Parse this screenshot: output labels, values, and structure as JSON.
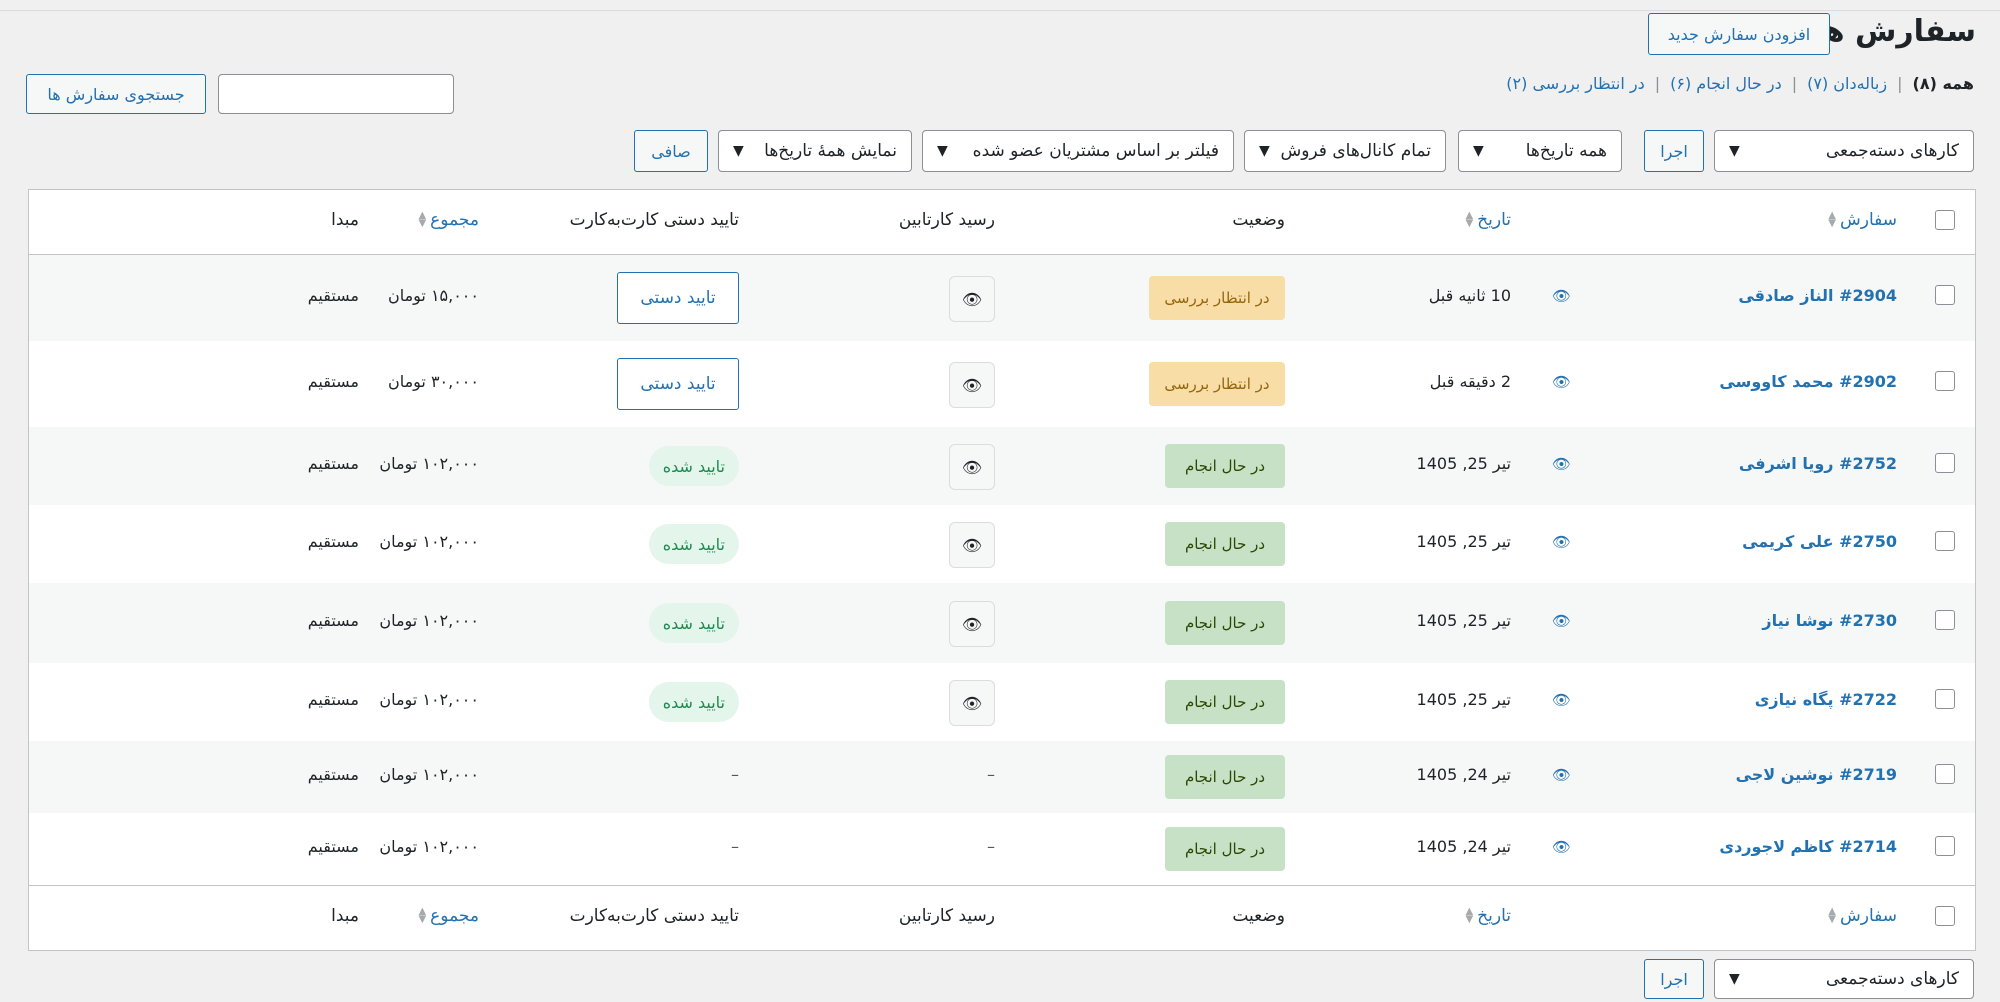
{
  "header": {
    "title": "سفارش ها",
    "add_new": "افزودن سفارش جدید"
  },
  "status_links": [
    {
      "label": "همه",
      "count": "(۸)"
    },
    {
      "label": "زباله‌دان",
      "count": "(۷)"
    },
    {
      "label": "در حال انجام",
      "count": "(۶)"
    },
    {
      "label": "در انتظار بررسی",
      "count": "(۲)"
    }
  ],
  "search": {
    "button": "جستجوی سفارش ها",
    "value": ""
  },
  "filters": {
    "bulk_actions": "کارهای دسته‌جمعی",
    "apply": "اجرا",
    "all_dates": "همه تاریخ‌ها",
    "sales_channels": "تمام کانال‌های فروش",
    "customer_filter": "فیلتر بر اساس مشتریان عضو شده",
    "show_all_dates": "نمایش همهٔ تاریخ‌ها",
    "filter_button": "صافی"
  },
  "columns": {
    "order": "سفارش",
    "date": "تاریخ",
    "status": "وضعیت",
    "receipt": "رسید کارتابین",
    "manual": "تایید دستی کارت‌به‌کارت",
    "total": "مجموع",
    "origin": "مبدا"
  },
  "orders": [
    {
      "name": "#2904 الناز صادقی",
      "date": "10 ثانیه قبل",
      "status": "در انتظار بررسی",
      "status_type": "pending",
      "receipt": "👁",
      "manual": "تایید دستی",
      "manual_type": "button",
      "total": "۱۵,۰۰۰ تومان",
      "origin": "مستقیم"
    },
    {
      "name": "#2902 محمد کاووسی",
      "date": "2 دقیقه قبل",
      "status": "در انتظار بررسی",
      "status_type": "pending",
      "receipt": "👁",
      "manual": "تایید دستی",
      "manual_type": "button",
      "total": "۳۰,۰۰۰ تومان",
      "origin": "مستقیم"
    },
    {
      "name": "#2752 رویا اشرفی",
      "date": "تیر 25, 1405",
      "status": "در حال انجام",
      "status_type": "processing",
      "receipt": "👁",
      "manual": "تایید شده",
      "manual_type": "approved",
      "total": "۱۰۲,۰۰۰ تومان",
      "origin": "مستقیم"
    },
    {
      "name": "#2750 علی کریمی",
      "date": "تیر 25, 1405",
      "status": "در حال انجام",
      "status_type": "processing",
      "receipt": "👁",
      "manual": "تایید شده",
      "manual_type": "approved",
      "total": "۱۰۲,۰۰۰ تومان",
      "origin": "مستقیم"
    },
    {
      "name": "#2730 نوشا نیاز",
      "date": "تیر 25, 1405",
      "status": "در حال انجام",
      "status_type": "processing",
      "receipt": "👁",
      "manual": "تایید شده",
      "manual_type": "approved",
      "total": "۱۰۲,۰۰۰ تومان",
      "origin": "مستقیم"
    },
    {
      "name": "#2722 پگاه نیازی",
      "date": "تیر 25, 1405",
      "status": "در حال انجام",
      "status_type": "processing",
      "receipt": "👁",
      "manual": "تایید شده",
      "manual_type": "approved",
      "total": "۱۰۲,۰۰۰ تومان",
      "origin": "مستقیم"
    },
    {
      "name": "#2719 نوشین لاجی",
      "date": "تیر 24, 1405",
      "status": "در حال انجام",
      "status_type": "processing",
      "receipt": "–",
      "manual": "–",
      "manual_type": "none",
      "total": "۱۰۲,۰۰۰ تومان",
      "origin": "مستقیم"
    },
    {
      "name": "#2714 کاظم لاجوردی",
      "date": "تیر 24, 1405",
      "status": "در حال انجام",
      "status_type": "processing",
      "receipt": "–",
      "manual": "–",
      "manual_type": "none",
      "total": "۱۰۲,۰۰۰ تومان",
      "origin": "مستقیم"
    }
  ],
  "colors": {
    "link": "#2271b1",
    "pending_bg": "#f8dda7",
    "processing_bg": "#c6e1c6"
  }
}
